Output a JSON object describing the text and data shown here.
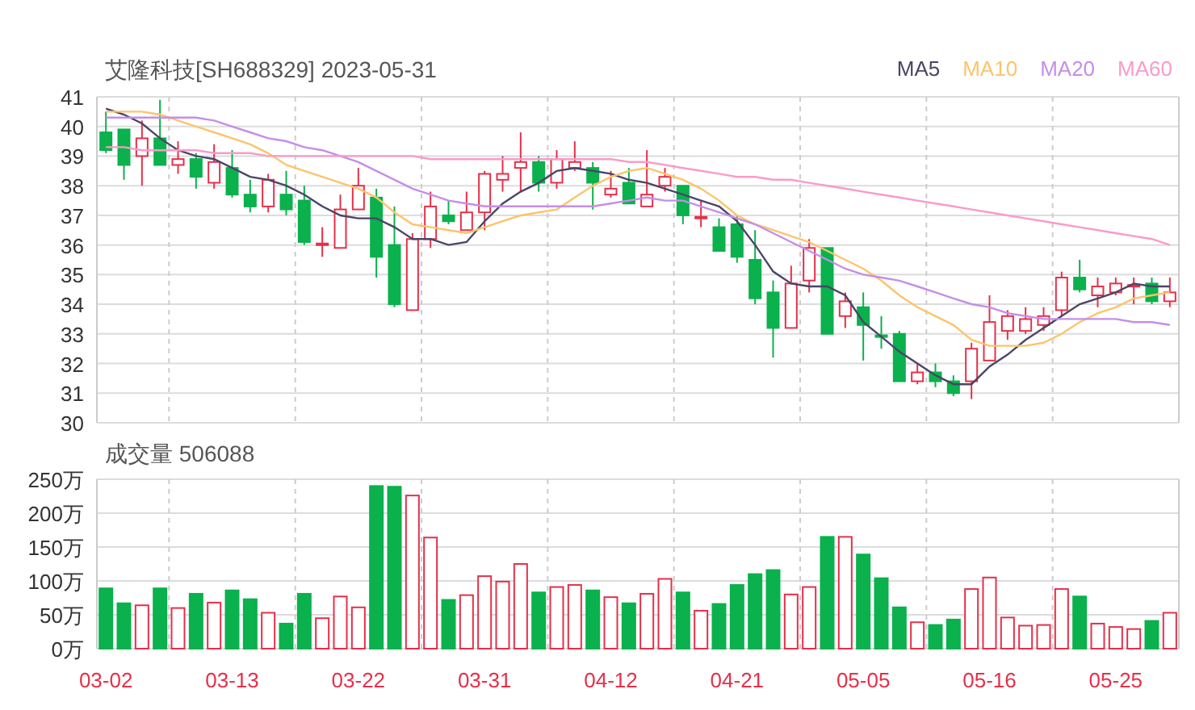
{
  "price_chart": {
    "title": "艾隆科技[SH688329] 2023-05-31",
    "chart_data": {
      "type": "candlestick",
      "categories": [
        null,
        null,
        null,
        null,
        null,
        null,
        null,
        null,
        null,
        null,
        null,
        null,
        null,
        null,
        null,
        null,
        null,
        null,
        null,
        null,
        null,
        null,
        null,
        null,
        null,
        null,
        null,
        null,
        null,
        null,
        null,
        null,
        null,
        null,
        null,
        null,
        null,
        null,
        null,
        null,
        null,
        null,
        null,
        null,
        null,
        null,
        null,
        null,
        null,
        null,
        null,
        null,
        null,
        null,
        null,
        null,
        null,
        null,
        null,
        null
      ],
      "ylim": [
        30,
        41
      ],
      "yticks": [
        30,
        31,
        32,
        33,
        34,
        35,
        36,
        37,
        38,
        39,
        40,
        41
      ],
      "grid": true,
      "ohlc": [
        [
          39.8,
          40.5,
          39.1,
          39.2
        ],
        [
          39.9,
          39.9,
          38.2,
          38.7
        ],
        [
          39.0,
          40.2,
          38.0,
          39.6
        ],
        [
          39.6,
          40.9,
          38.7,
          38.7
        ],
        [
          38.7,
          39.5,
          38.4,
          38.9
        ],
        [
          38.9,
          39.1,
          37.9,
          38.3
        ],
        [
          38.1,
          39.4,
          37.9,
          38.8
        ],
        [
          38.6,
          39.2,
          37.6,
          37.7
        ],
        [
          37.7,
          38.2,
          37.1,
          37.3
        ],
        [
          37.3,
          38.4,
          37.1,
          38.2
        ],
        [
          37.7,
          38.5,
          37.0,
          37.2
        ],
        [
          37.5,
          38.0,
          36.0,
          36.1
        ],
        [
          36.0,
          36.6,
          35.6,
          36.05
        ],
        [
          35.9,
          37.7,
          35.9,
          37.2
        ],
        [
          37.2,
          38.6,
          37.2,
          38.0
        ],
        [
          37.6,
          37.9,
          34.9,
          35.6
        ],
        [
          36.0,
          37.3,
          33.9,
          34.0
        ],
        [
          33.8,
          36.4,
          33.8,
          36.2
        ],
        [
          36.2,
          37.8,
          35.9,
          37.3
        ],
        [
          37.0,
          37.5,
          36.7,
          36.8
        ],
        [
          36.5,
          37.8,
          36.5,
          37.1
        ],
        [
          37.1,
          38.5,
          36.5,
          38.4
        ],
        [
          38.2,
          39.0,
          37.8,
          38.4
        ],
        [
          38.6,
          39.8,
          37.8,
          38.8
        ],
        [
          38.8,
          39.0,
          37.8,
          38.1
        ],
        [
          38.1,
          39.2,
          37.9,
          38.9
        ],
        [
          38.6,
          39.5,
          38.5,
          38.8
        ],
        [
          38.6,
          38.8,
          37.2,
          38.1
        ],
        [
          37.7,
          38.5,
          37.6,
          37.9
        ],
        [
          38.1,
          38.6,
          37.4,
          37.4
        ],
        [
          37.3,
          39.2,
          37.3,
          37.7
        ],
        [
          38.0,
          38.6,
          37.8,
          38.3
        ],
        [
          38.0,
          38.0,
          36.7,
          37.0
        ],
        [
          36.9,
          37.5,
          36.6,
          36.95
        ],
        [
          36.6,
          36.9,
          35.8,
          35.8
        ],
        [
          36.7,
          37.0,
          35.4,
          35.6
        ],
        [
          35.5,
          36.5,
          34.0,
          34.2
        ],
        [
          34.4,
          34.8,
          32.2,
          33.2
        ],
        [
          33.2,
          35.3,
          33.2,
          34.7
        ],
        [
          34.8,
          36.2,
          34.4,
          35.9
        ],
        [
          35.9,
          35.9,
          33.0,
          33.0
        ],
        [
          33.6,
          34.4,
          33.2,
          34.1
        ],
        [
          33.9,
          34.4,
          32.1,
          33.3
        ],
        [
          32.95,
          33.6,
          32.5,
          32.9
        ],
        [
          33.0,
          33.1,
          31.4,
          31.4
        ],
        [
          31.4,
          32.0,
          31.3,
          31.7
        ],
        [
          31.7,
          32.0,
          31.2,
          31.4
        ],
        [
          31.4,
          31.6,
          30.9,
          31.0
        ],
        [
          31.4,
          32.7,
          30.8,
          32.5
        ],
        [
          32.1,
          34.3,
          32.1,
          33.4
        ],
        [
          33.1,
          33.8,
          32.8,
          33.6
        ],
        [
          33.1,
          33.9,
          33.0,
          33.5
        ],
        [
          33.3,
          33.9,
          33.1,
          33.6
        ],
        [
          33.8,
          35.1,
          33.6,
          34.9
        ],
        [
          34.9,
          35.5,
          34.4,
          34.5
        ],
        [
          34.3,
          34.9,
          33.9,
          34.6
        ],
        [
          34.4,
          34.9,
          34.3,
          34.7
        ],
        [
          34.6,
          34.9,
          34.0,
          34.65
        ],
        [
          34.7,
          34.9,
          34.0,
          34.1
        ],
        [
          34.1,
          34.9,
          33.9,
          34.4
        ]
      ],
      "series": [
        {
          "name": "MA5",
          "type": "line",
          "color": "#4b4566",
          "values": [
            40.6,
            40.4,
            40.1,
            39.6,
            39.2,
            39.0,
            38.9,
            38.6,
            38.3,
            38.2,
            38.0,
            37.7,
            37.3,
            37.0,
            36.9,
            36.9,
            36.6,
            36.2,
            36.2,
            36.0,
            36.1,
            36.8,
            37.4,
            37.8,
            38.1,
            38.5,
            38.6,
            38.5,
            38.4,
            38.2,
            38.1,
            37.9,
            37.7,
            37.5,
            37.3,
            36.8,
            36.0,
            35.1,
            34.7,
            34.6,
            34.6,
            34.3,
            33.4,
            32.9,
            32.4,
            32.0,
            31.6,
            31.3,
            31.3,
            31.9,
            32.3,
            32.8,
            33.2,
            33.6,
            34.0,
            34.2,
            34.4,
            34.7,
            34.6,
            34.6
          ]
        },
        {
          "name": "MA10",
          "type": "line",
          "color": "#fcc46c",
          "values": [
            40.5,
            40.5,
            40.5,
            40.4,
            40.2,
            40.0,
            39.8,
            39.6,
            39.4,
            39.1,
            38.7,
            38.5,
            38.3,
            38.1,
            37.9,
            37.6,
            37.1,
            36.7,
            36.6,
            36.5,
            36.4,
            36.6,
            36.8,
            37.0,
            37.1,
            37.2,
            37.6,
            38.0,
            38.3,
            38.5,
            38.6,
            38.4,
            38.2,
            37.9,
            37.5,
            37.0,
            36.7,
            36.5,
            36.3,
            36.1,
            35.8,
            35.5,
            35.2,
            34.8,
            34.3,
            33.9,
            33.6,
            33.3,
            32.8,
            32.6,
            32.6,
            32.6,
            32.7,
            33.0,
            33.4,
            33.7,
            33.9,
            34.2,
            34.3,
            34.4
          ]
        },
        {
          "name": "MA20",
          "type": "line",
          "color": "#c58ee8",
          "values": [
            40.3,
            40.3,
            40.3,
            40.3,
            40.3,
            40.3,
            40.2,
            40.0,
            39.8,
            39.6,
            39.5,
            39.3,
            39.2,
            39.0,
            38.8,
            38.5,
            38.2,
            37.9,
            37.7,
            37.5,
            37.4,
            37.3,
            37.3,
            37.3,
            37.3,
            37.3,
            37.3,
            37.3,
            37.4,
            37.5,
            37.6,
            37.5,
            37.5,
            37.3,
            37.1,
            36.9,
            36.7,
            36.4,
            36.1,
            35.8,
            35.5,
            35.2,
            35.0,
            34.9,
            34.8,
            34.6,
            34.4,
            34.2,
            34.0,
            33.9,
            33.7,
            33.6,
            33.5,
            33.5,
            33.5,
            33.5,
            33.5,
            33.4,
            33.4,
            33.3
          ]
        },
        {
          "name": "MA60",
          "type": "line",
          "color": "#f99bc8",
          "values": [
            39.3,
            39.3,
            39.2,
            39.2,
            39.2,
            39.2,
            39.1,
            39.1,
            39.1,
            39.0,
            39.0,
            39.0,
            39.0,
            39.0,
            39.0,
            39.0,
            39.0,
            39.0,
            38.9,
            38.9,
            38.9,
            38.9,
            38.9,
            38.9,
            38.9,
            38.9,
            38.9,
            38.9,
            38.9,
            38.8,
            38.8,
            38.7,
            38.6,
            38.5,
            38.4,
            38.3,
            38.3,
            38.2,
            38.2,
            38.1,
            38.0,
            37.9,
            37.8,
            37.7,
            37.6,
            37.5,
            37.4,
            37.3,
            37.2,
            37.1,
            37.0,
            36.9,
            36.8,
            36.7,
            36.6,
            36.5,
            36.4,
            36.3,
            36.2,
            36.0
          ]
        }
      ]
    }
  },
  "volume_chart": {
    "chart_data": {
      "type": "bar",
      "title": "成交量 506088",
      "ylim": [
        0,
        250
      ],
      "grid": true,
      "yticks": [
        {
          "value": 0,
          "label": "0万"
        },
        {
          "value": 50,
          "label": "50万"
        },
        {
          "value": 100,
          "label": "100万"
        },
        {
          "value": 150,
          "label": "150万"
        },
        {
          "value": 200,
          "label": "200万"
        },
        {
          "value": 250,
          "label": "250万"
        }
      ],
      "categories": [
        "03-02",
        null,
        null,
        null,
        null,
        null,
        null,
        "03-13",
        null,
        null,
        null,
        null,
        null,
        null,
        "03-22",
        null,
        null,
        null,
        null,
        null,
        null,
        "03-31",
        null,
        null,
        null,
        null,
        null,
        null,
        "04-12",
        null,
        null,
        null,
        null,
        null,
        null,
        "04-21",
        null,
        null,
        null,
        null,
        null,
        null,
        "05-05",
        null,
        null,
        null,
        null,
        null,
        null,
        "05-16",
        null,
        null,
        null,
        null,
        null,
        null,
        "05-25",
        null,
        null,
        null
      ],
      "series": [
        {
          "values": [
            89,
            67,
            64,
            89,
            60,
            81,
            68,
            86,
            73,
            53,
            37,
            81,
            45,
            77,
            61,
            240,
            239,
            226,
            164,
            72,
            79,
            107,
            99,
            125,
            83,
            91,
            94,
            86,
            76,
            67,
            81,
            103,
            83,
            56,
            66,
            94,
            110,
            116,
            80,
            91,
            165,
            165,
            139,
            104,
            61,
            39,
            35,
            43,
            88,
            105,
            46,
            34,
            35,
            88,
            77,
            37,
            32,
            29,
            41,
            53
          ]
        }
      ]
    }
  }
}
